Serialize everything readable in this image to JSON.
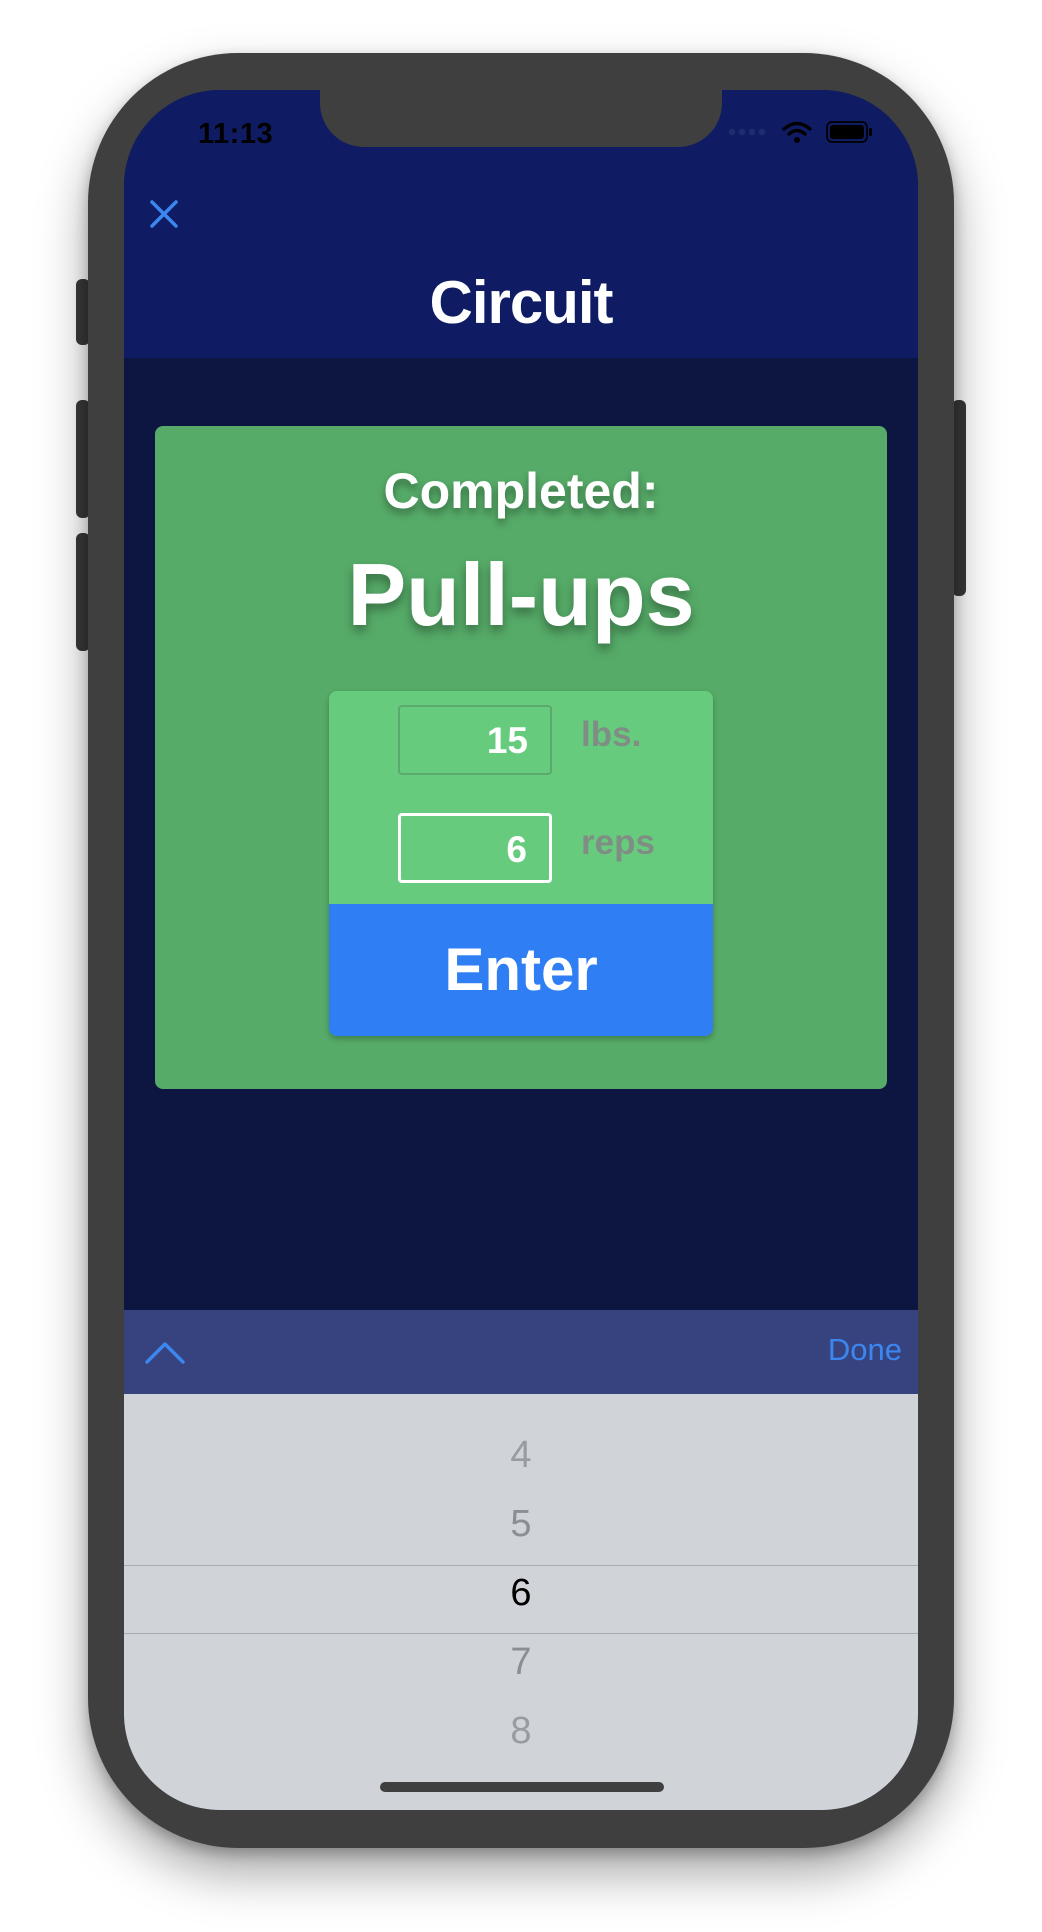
{
  "status_bar": {
    "time": "11:13"
  },
  "nav": {
    "title": "Circuit"
  },
  "card": {
    "completed_label": "Completed:",
    "exercise": "Pull-ups",
    "weight": {
      "value": "15",
      "unit": "lbs."
    },
    "reps": {
      "value": "6",
      "unit": "reps"
    },
    "enter_label": "Enter"
  },
  "toolbar": {
    "done_label": "Done"
  },
  "picker": {
    "items": [
      "4",
      "5",
      "6",
      "7",
      "8"
    ],
    "selected": "6"
  },
  "colors": {
    "nav_bg": "#0f1c63",
    "screen_bg": "#0d1541",
    "card_bg": "#56ab68",
    "entry_bg": "#67cb7d",
    "enter_button": "#2f7ef4",
    "toolbar_bg": "#37437e",
    "picker_bg": "#d0d4d9",
    "accent_blue": "#3c86f0"
  },
  "icons": [
    "close-icon",
    "wifi-icon",
    "battery-icon",
    "signal-icon",
    "chevron-up-icon"
  ]
}
